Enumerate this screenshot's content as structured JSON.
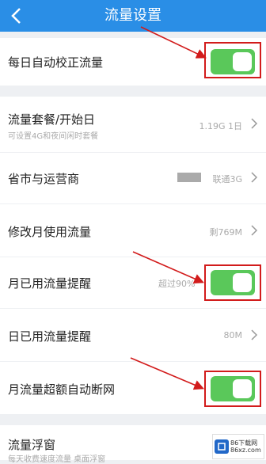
{
  "header": {
    "title": "流量设置",
    "back_icon": "chevron-left-icon"
  },
  "rows": {
    "auto_calibrate": {
      "label": "每日自动校正流量",
      "toggle_on": true
    },
    "plan": {
      "label": "流量套餐/开始日",
      "subtitle": "可设置4G和夜间闲时套餐",
      "value": "1.19G 1日"
    },
    "carrier": {
      "label": "省市与运营商",
      "value": "联通3G"
    },
    "monthly_used": {
      "label": "修改月使用流量",
      "value": "剩769M"
    },
    "monthly_alert": {
      "label": "月已用流量提醒",
      "value": "超过90%",
      "toggle_on": true
    },
    "daily_alert": {
      "label": "日已用流量提醒",
      "value": "80M"
    },
    "auto_disconnect": {
      "label": "月流量超额自动断网",
      "toggle_on": true
    },
    "floating": {
      "label": "流量浮窗",
      "subtitle": "每天收费速度流量 桌面浮窗"
    }
  },
  "colors": {
    "header": "#2a8ee6",
    "toggle": "#5ac85a",
    "highlight": "#d21b1b"
  }
}
